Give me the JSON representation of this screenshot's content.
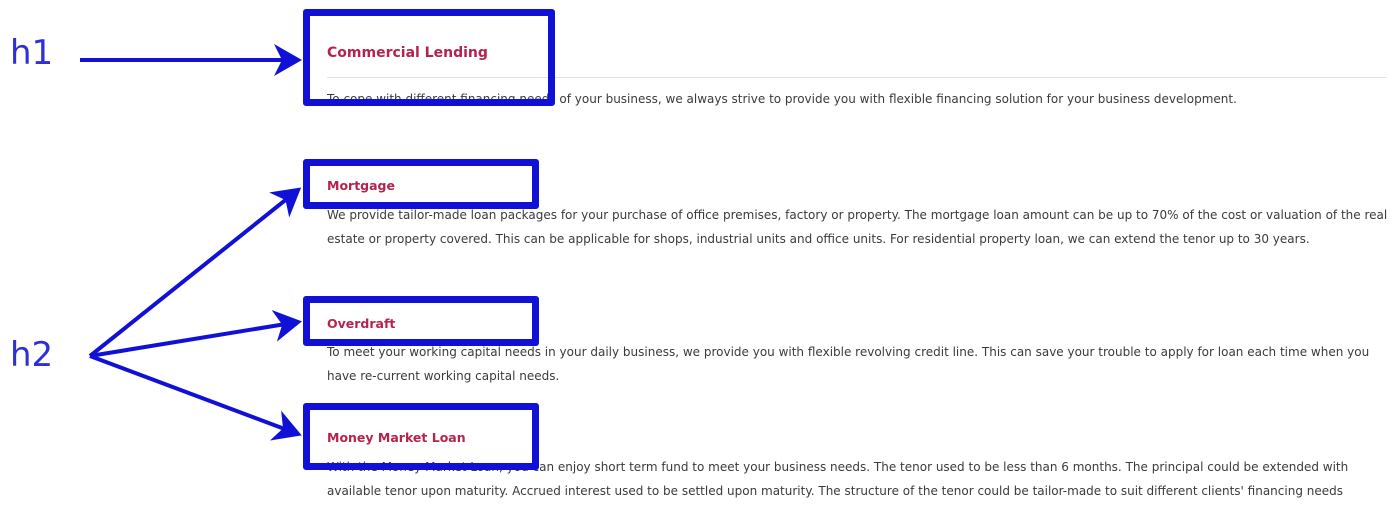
{
  "labels": {
    "h1": "h1",
    "h2": "h2"
  },
  "content": {
    "main_heading": "Commercial Lending",
    "intro": "To cope with different financing needs of your business, we always strive to provide you with flexible financing solution for your business development.",
    "sections": [
      {
        "heading": "Mortgage",
        "body": "We provide tailor-made loan packages for your purchase of office premises, factory or property. The mortgage loan amount can be up to 70% of the cost or valuation of the real estate or property covered. This can be applicable for shops, industrial units and office units. For residential property loan, we can extend the tenor up to 30 years."
      },
      {
        "heading": "Overdraft",
        "body": "To meet your working capital needs in your daily business, we provide you with flexible revolving credit line. This can save your trouble to apply for loan each time when you have re-current working capital needs."
      },
      {
        "heading": "Money Market Loan",
        "body": "With the Money Market Loan, you can enjoy short term fund to meet your business needs. The tenor used to be less than 6 months. The principal could be extended with available tenor upon maturity. Accrued interest used to be settled upon maturity. The structure of the tenor could be tailor-made to suit different clients' financing needs"
      }
    ]
  },
  "colors": {
    "heading": "#b5234c",
    "annotation": "#1010d6",
    "label": "#2f2fd8",
    "body_text": "#3b3b3b"
  }
}
